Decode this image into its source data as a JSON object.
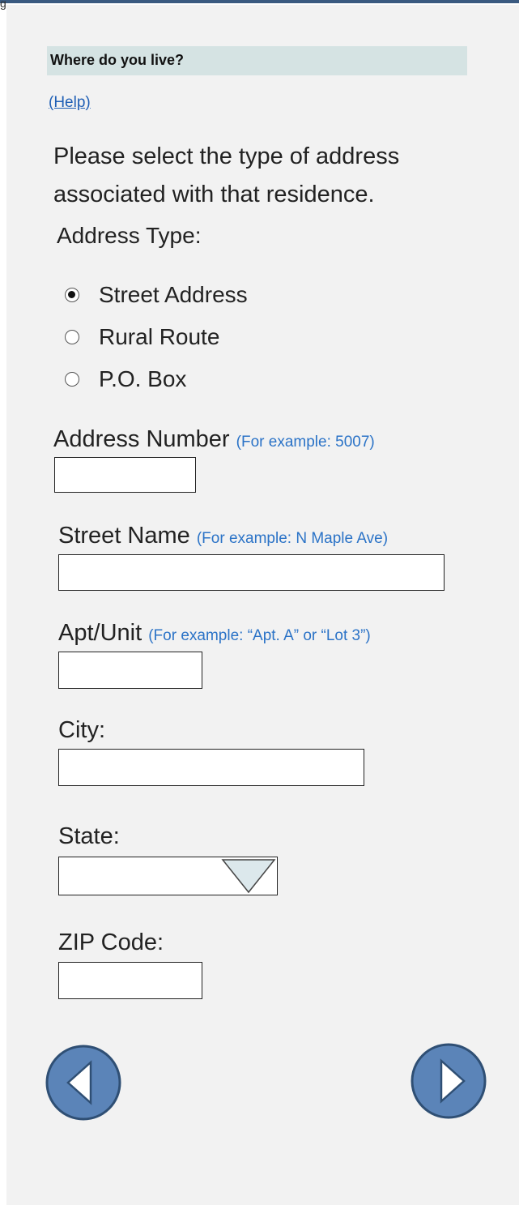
{
  "form": {
    "question": "Where do you live?",
    "help_link": "(Help)",
    "instructions": "Please select the type of address associated with that residence.",
    "address_type_label": "Address Type:",
    "address_type_options": [
      {
        "label": "Street Address",
        "selected": true
      },
      {
        "label": "Rural Route",
        "selected": false
      },
      {
        "label": "P.O. Box",
        "selected": false
      }
    ],
    "fields": {
      "address_number": {
        "label": "Address Number",
        "hint": "(For example: 5007)",
        "value": ""
      },
      "street_name": {
        "label": "Street Name",
        "hint": "(For example: N Maple Ave)",
        "value": ""
      },
      "apt_unit": {
        "label": "Apt/Unit",
        "hint": "(For example: “Apt. A” or “Lot 3”)",
        "value": ""
      },
      "city": {
        "label": "City:",
        "value": ""
      },
      "state": {
        "label": "State:",
        "selected": ""
      },
      "zip": {
        "label": "ZIP Code:",
        "value": ""
      }
    }
  },
  "navigation": {
    "back_icon": "left-triangle-circle-icon",
    "next_icon": "right-triangle-circle-icon"
  },
  "colors": {
    "banner": "#d5e3e3",
    "link": "#1f5fb5",
    "hint": "#2b73c7",
    "nav_button_fill": "#5b84b8",
    "nav_button_stroke": "#2f4f74",
    "panel": "#f2f2f2"
  }
}
